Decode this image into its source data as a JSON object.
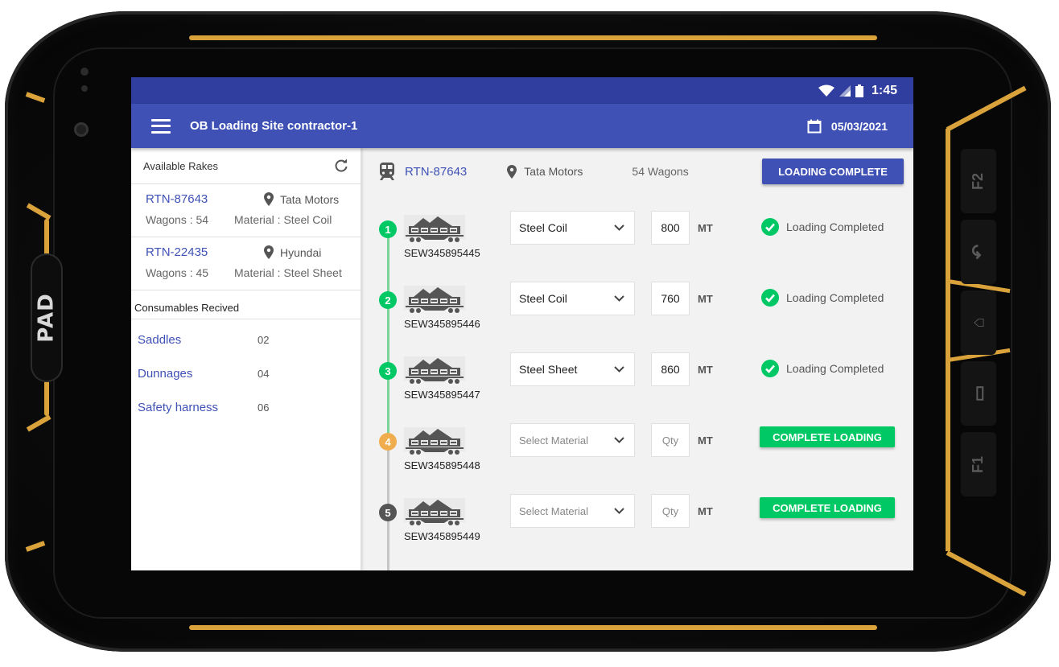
{
  "status_bar": {
    "time": "1:45",
    "icons": [
      "wifi-icon",
      "signal-icon",
      "battery-icon"
    ]
  },
  "app_bar": {
    "title": "OB Loading Site contractor-1",
    "date": "05/03/2021",
    "menu_icon": "hamburger-menu-icon",
    "date_icon": "calendar-icon"
  },
  "colors": {
    "primary": "#3f51b5",
    "primary_dark": "#303f9f",
    "success": "#00c864",
    "pending": "#f0ad4e",
    "inactive": "#555555",
    "accent_frame": "#d9a23a"
  },
  "device": {
    "badge": "PAD",
    "side_keys": [
      "F2",
      "back",
      "home",
      "menu",
      "F1"
    ]
  },
  "sidebar": {
    "rakes_title": "Available Rakes",
    "refresh_icon": "refresh-icon",
    "rakes": [
      {
        "id": "RTN-87643",
        "location": "Tata Motors",
        "wagons": "Wagons : 54",
        "material": "Material : Steel Coil"
      },
      {
        "id": "RTN-22435",
        "location": "Hyundai",
        "wagons": "Wagons : 45",
        "material": "Material : Steel Sheet"
      }
    ],
    "consumables_title": "Consumables Recived",
    "consumables": [
      {
        "name": "Saddles",
        "qty": "02"
      },
      {
        "name": "Dunnages",
        "qty": "04"
      },
      {
        "name": "Safety harness",
        "qty": "06"
      }
    ]
  },
  "main": {
    "rake_id": "RTN-87643",
    "location": "Tata Motors",
    "wagons": "54 Wagons",
    "loading_complete_button": "LOADING COMPLETE",
    "unit": "MT",
    "material_placeholder": "Select Material",
    "qty_placeholder": "Qty",
    "complete_loading_button": "COMPLETE LOADING",
    "completed_label": "Loading Completed",
    "wagon_rows": [
      {
        "step": "1",
        "wagon_id": "SEW345895445",
        "material": "Steel Coil",
        "qty": "800",
        "state": "completed"
      },
      {
        "step": "2",
        "wagon_id": "SEW345895446",
        "material": "Steel Coil",
        "qty": "760",
        "state": "completed"
      },
      {
        "step": "3",
        "wagon_id": "SEW345895447",
        "material": "Steel Sheet",
        "qty": "860",
        "state": "completed"
      },
      {
        "step": "4",
        "wagon_id": "SEW345895448",
        "material": "",
        "qty": "",
        "state": "pending"
      },
      {
        "step": "5",
        "wagon_id": "SEW345895449",
        "material": "",
        "qty": "",
        "state": "inactive"
      }
    ]
  }
}
